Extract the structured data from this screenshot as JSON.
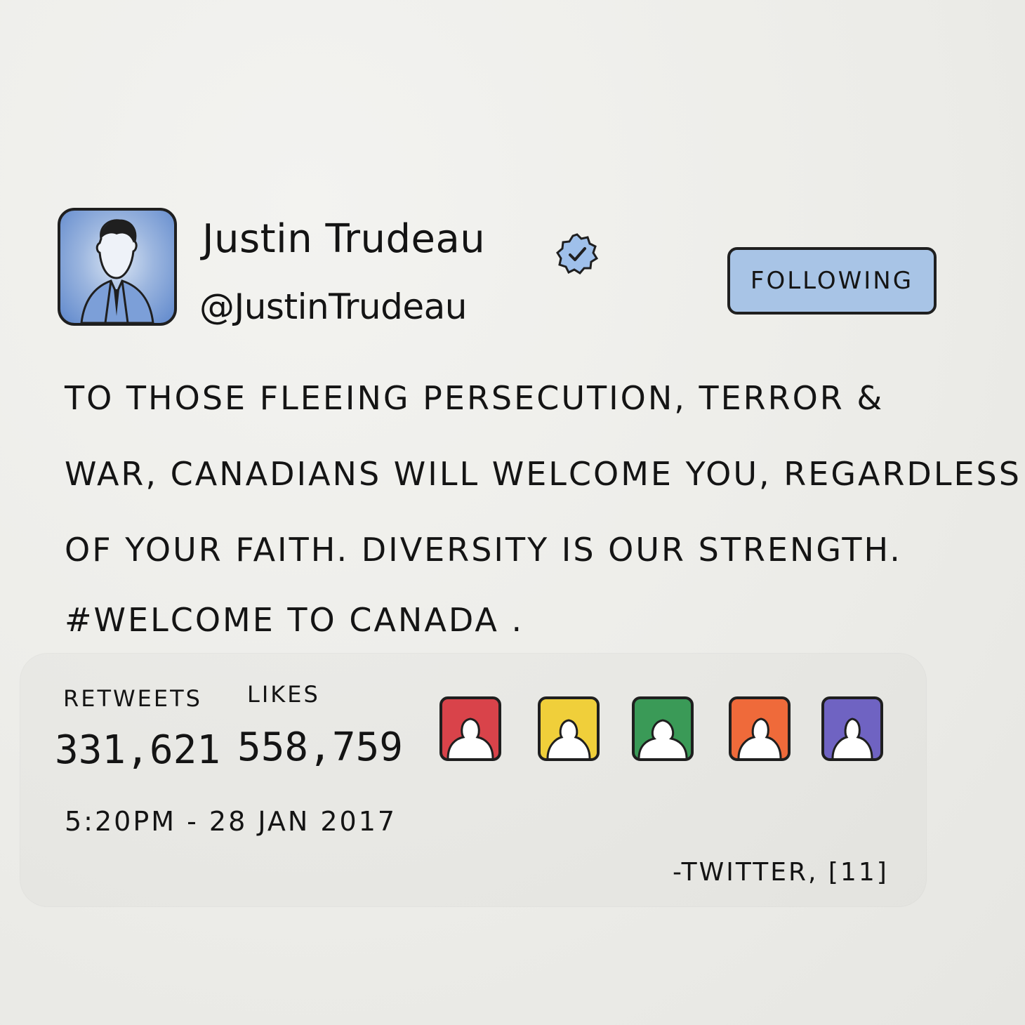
{
  "tweet": {
    "author_name": "Justin Trudeau",
    "handle": "@JustinTrudeau",
    "verified_icon": "verified-badge-icon",
    "follow_button_label": "FOLLOWING",
    "text_lines": [
      "TO THOSE FLEEING PERSECUTION, TERROR &",
      "WAR, CANADIANS WILL WELCOME YOU, REGARDLESS",
      "OF YOUR FAITH. DIVERSITY IS OUR STRENGTH.",
      "#WELCOME TO CANADA ."
    ],
    "stats": {
      "retweets_label": "RETWEETS",
      "retweets_count": "331,621",
      "likes_label": "LIKES",
      "likes_count": "558,759"
    },
    "likers": [
      {
        "icon": "person-avatar-icon",
        "color": "#d9434a"
      },
      {
        "icon": "person-avatar-icon",
        "color": "#f0cf3a"
      },
      {
        "icon": "person-avatar-icon",
        "color": "#3a9a57"
      },
      {
        "icon": "person-avatar-icon",
        "color": "#ef6a3a"
      },
      {
        "icon": "person-avatar-icon",
        "color": "#6f63c2"
      }
    ],
    "timestamp": "5:20PM - 28 JAN 2017"
  },
  "source": "-TWITTER, [11]",
  "colors": {
    "avatar_blue": "#5f88cc",
    "follow_button": "#a8c4e6",
    "ink": "#141414"
  }
}
